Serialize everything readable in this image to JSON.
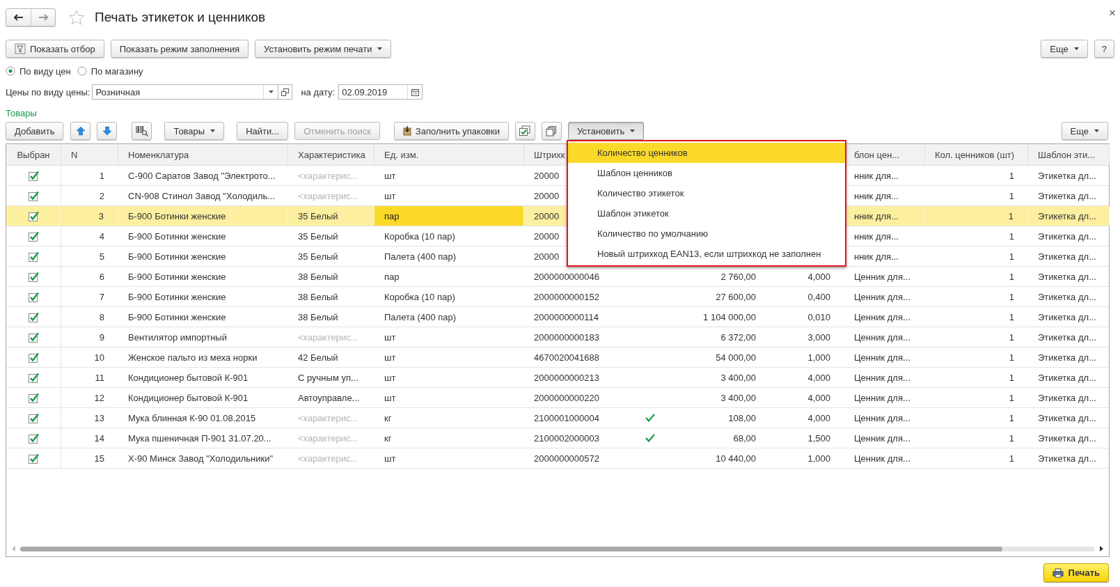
{
  "window": {
    "title": "Печать этикеток и ценников",
    "close": "×"
  },
  "top_buttons": [
    {
      "label": "Показать отбор",
      "kind": "filter"
    },
    {
      "label": "Показать режим заполнения",
      "kind": "plain"
    },
    {
      "label": "Установить режим печати",
      "kind": "menu"
    }
  ],
  "top_more": "Еще",
  "help": "?",
  "radios": [
    {
      "label": "По виду цен",
      "selected": true
    },
    {
      "label": "По магазину",
      "selected": false
    }
  ],
  "price_type": {
    "label": "Цены по виду цены:",
    "value": "Розничная"
  },
  "date": {
    "label": "на дату:",
    "value": "02.09.2019"
  },
  "section_title": "Товары",
  "table_toolbar": [
    {
      "label": "Добавить",
      "kind": "text",
      "disabled": false,
      "pressed": false
    },
    {
      "kind": "up",
      "disabled": false,
      "pressed": false
    },
    {
      "kind": "down",
      "disabled": false,
      "pressed": false
    },
    {
      "kind": "barcode",
      "disabled": false,
      "pressed": false
    },
    {
      "label": "Товары",
      "kind": "menu",
      "disabled": false,
      "pressed": false
    },
    {
      "label": "Найти...",
      "kind": "text",
      "disabled": false,
      "pressed": false
    },
    {
      "label": "Отменить поиск",
      "kind": "text",
      "disabled": true,
      "pressed": false
    },
    {
      "label": "Заполнить упаковки",
      "kind": "fill",
      "disabled": false,
      "pressed": false
    },
    {
      "kind": "checkall",
      "disabled": false,
      "pressed": false
    },
    {
      "kind": "copy",
      "disabled": false,
      "pressed": false
    },
    {
      "label": "Установить",
      "kind": "menu",
      "disabled": false,
      "pressed": true
    }
  ],
  "table_more": "Еще",
  "columns": [
    "Выбран",
    "N",
    "Номенклатура",
    "Характеристика",
    "Ед. изм.",
    "Штрихк",
    null,
    null,
    null,
    "блон цен...",
    "Кол. ценников (шт)",
    "Шаблон эти..."
  ],
  "rows": [
    {
      "checked": true,
      "selected": false,
      "n": "1",
      "name": "С-900 Саратов Завод \"Электрото...",
      "char": "<характерис...",
      "char_placeholder": true,
      "unit": "шт",
      "barcode": "20000",
      "template": "нник для...",
      "count": "1",
      "label": "Этикетка дл..."
    },
    {
      "checked": true,
      "selected": false,
      "n": "2",
      "name": "CN-908 Стинол Завод \"Холодиль...",
      "char": "<характерис...",
      "char_placeholder": true,
      "unit": "шт",
      "barcode": "20000",
      "template": "нник для...",
      "count": "1",
      "label": "Этикетка дл..."
    },
    {
      "checked": true,
      "selected": true,
      "unit_active": true,
      "n": "3",
      "name": "Б-900 Ботинки женские",
      "char": "35 Белый",
      "char_placeholder": false,
      "unit": "пар",
      "barcode": "20000",
      "template": "нник для...",
      "count": "1",
      "label": "Этикетка дл..."
    },
    {
      "checked": true,
      "selected": false,
      "n": "4",
      "name": "Б-900 Ботинки женские",
      "char": "35 Белый",
      "char_placeholder": false,
      "unit": "Коробка (10 пар)",
      "barcode": "20000",
      "template": "нник для...",
      "count": "1",
      "label": "Этикетка дл..."
    },
    {
      "checked": true,
      "selected": false,
      "n": "5",
      "name": "Б-900 Ботинки женские",
      "char": "35 Белый",
      "char_placeholder": false,
      "unit": "Палета (400 пар)",
      "barcode": "20000",
      "template": "нник для...",
      "count": "1",
      "label": "Этикетка дл..."
    },
    {
      "checked": true,
      "selected": false,
      "n": "6",
      "name": "Б-900 Ботинки женские",
      "char": "38 Белый",
      "char_placeholder": false,
      "unit": "пар",
      "barcode": "2000000000046",
      "marked": false,
      "price": "2 760,00",
      "qty": "4,000",
      "template": "Ценник для...",
      "count": "1",
      "label": "Этикетка дл..."
    },
    {
      "checked": true,
      "selected": false,
      "n": "7",
      "name": "Б-900 Ботинки женские",
      "char": "38 Белый",
      "char_placeholder": false,
      "unit": "Коробка (10 пар)",
      "barcode": "2000000000152",
      "marked": false,
      "price": "27 600,00",
      "qty": "0,400",
      "template": "Ценник для...",
      "count": "1",
      "label": "Этикетка дл..."
    },
    {
      "checked": true,
      "selected": false,
      "n": "8",
      "name": "Б-900 Ботинки женские",
      "char": "38 Белый",
      "char_placeholder": false,
      "unit": "Палета (400 пар)",
      "barcode": "2000000000114",
      "marked": false,
      "price": "1 104 000,00",
      "qty": "0,010",
      "template": "Ценник для...",
      "count": "1",
      "label": "Этикетка дл..."
    },
    {
      "checked": true,
      "selected": false,
      "n": "9",
      "name": "Вентилятор импортный",
      "char": "<характерис...",
      "char_placeholder": true,
      "unit": "шт",
      "barcode": "2000000000183",
      "marked": false,
      "price": "6 372,00",
      "qty": "3,000",
      "template": "Ценник для...",
      "count": "1",
      "label": "Этикетка дл..."
    },
    {
      "checked": true,
      "selected": false,
      "n": "10",
      "name": "Женское пальто из меха норки",
      "char": "42 Белый",
      "char_placeholder": false,
      "unit": "шт",
      "barcode": "4670020041688",
      "marked": false,
      "price": "54 000,00",
      "qty": "1,000",
      "template": "Ценник для...",
      "count": "1",
      "label": "Этикетка дл..."
    },
    {
      "checked": true,
      "selected": false,
      "n": "11",
      "name": "Кондиционер бытовой К-901",
      "char": "С ручным уп...",
      "char_placeholder": false,
      "unit": "шт",
      "barcode": "2000000000213",
      "marked": false,
      "price": "3 400,00",
      "qty": "4,000",
      "template": "Ценник для...",
      "count": "1",
      "label": "Этикетка дл..."
    },
    {
      "checked": true,
      "selected": false,
      "n": "12",
      "name": "Кондиционер бытовой К-901",
      "char": "Автоуправле...",
      "char_placeholder": false,
      "unit": "шт",
      "barcode": "2000000000220",
      "marked": false,
      "price": "3 400,00",
      "qty": "4,000",
      "template": "Ценник для...",
      "count": "1",
      "label": "Этикетка дл..."
    },
    {
      "checked": true,
      "selected": false,
      "n": "13",
      "name": "Мука блинная  К-90 01.08.2015",
      "char": "<характерис...",
      "char_placeholder": true,
      "unit": "кг",
      "barcode": "2100001000004",
      "marked": true,
      "price": "108,00",
      "qty": "4,000",
      "template": "Ценник для...",
      "count": "1",
      "label": "Этикетка дл..."
    },
    {
      "checked": true,
      "selected": false,
      "n": "14",
      "name": "Мука пшеничная П-901  31.07.20...",
      "char": "<характерис...",
      "char_placeholder": true,
      "unit": "кг",
      "barcode": "2100002000003",
      "marked": true,
      "price": "68,00",
      "qty": "1,500",
      "template": "Ценник для...",
      "count": "1",
      "label": "Этикетка дл..."
    },
    {
      "checked": true,
      "selected": false,
      "n": "15",
      "name": "Х-90 Минск Завод \"Холодильники\"",
      "char": "<характерис...",
      "char_placeholder": true,
      "unit": "шт",
      "barcode": "2000000000572",
      "marked": false,
      "price": "10 440,00",
      "qty": "1,000",
      "template": "Ценник для...",
      "count": "1",
      "label": "Этикетка дл..."
    }
  ],
  "set_menu": [
    {
      "label": "Количество ценников",
      "selected": true
    },
    {
      "label": "Шаблон ценников",
      "selected": false
    },
    {
      "label": "Количество этикеток",
      "selected": false
    },
    {
      "label": "Шаблон этикеток",
      "selected": false
    },
    {
      "label": "Количество по умолчанию",
      "selected": false
    },
    {
      "label": "Новый штрихкод EAN13, если штрихкод не заполнен",
      "selected": false
    }
  ],
  "print_button": "Печать"
}
